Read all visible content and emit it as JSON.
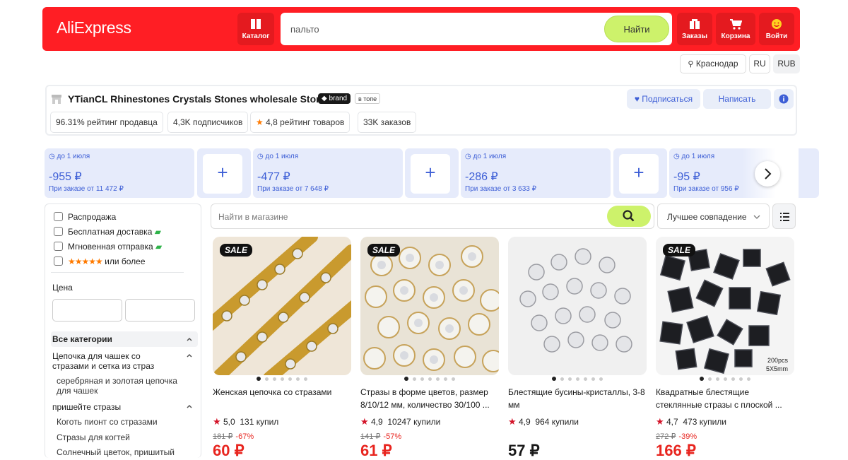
{
  "header": {
    "logo": "AliExpress",
    "catalog_label": "Каталог",
    "search_value": "пальто",
    "search_button": "Найти",
    "orders_label": "Заказы",
    "cart_label": "Корзина",
    "login_label": "Войти"
  },
  "region": {
    "city": "Краснодар",
    "lang": "RU",
    "currency": "RUB"
  },
  "store": {
    "name": "YTianCL Rhinestones Crystals Stones wholesale Store",
    "brand_badge": "brand",
    "top_badge": "в топе",
    "stats": [
      "96.31% рейтинг продавца",
      "4,3K подписчиков",
      "4,8 рейтинг товаров",
      "33K заказов"
    ],
    "follow_label": "Подписаться",
    "write_label": "Написать"
  },
  "coupons": [
    {
      "date": "до 1 июля",
      "amount": "-955 ₽",
      "condition": "При заказе от 11 472 ₽"
    },
    {
      "date": "до 1 июля",
      "amount": "-477 ₽",
      "condition": "При заказе от 7 648 ₽"
    },
    {
      "date": "до 1 июля",
      "amount": "-286 ₽",
      "condition": "При заказе от 3 633 ₽"
    },
    {
      "date": "до 1 июля",
      "amount": "-95 ₽",
      "condition": "При заказе от 956 ₽"
    }
  ],
  "filters": {
    "checkboxes": [
      "Распродажа",
      "Бесплатная доставка",
      "Мгновенная отправка",
      "или более"
    ],
    "price_label": "Цена",
    "all_categories": "Все категории",
    "cat1": "Цепочка для чашек со стразами и сетка из страз",
    "cat1_sub": "серебряная и золотая цепочка для чашек",
    "cat2": "пришейте стразы",
    "cat2_items": [
      "Коготь пионт со стразами",
      "Стразы для когтей",
      "Солнечный цветок, пришитый"
    ]
  },
  "shop_search": {
    "placeholder": "Найти в магазине",
    "sort": "Лучшее совпадение"
  },
  "products": [
    {
      "sale": "SALE",
      "title": "Женская цепочка со стразами",
      "rating": "5,0",
      "sold": "131 купил",
      "old_price": "181 ₽",
      "discount": "-67%",
      "price": "60 ₽"
    },
    {
      "sale": "SALE",
      "title": "Стразы в форме цветов, размер 8/10/12 мм, количество 30/100 ...",
      "rating": "4,9",
      "sold": "10247 купили",
      "old_price": "141 ₽",
      "discount": "-57%",
      "price": "61 ₽"
    },
    {
      "sale": "",
      "title": "Блестящие бусины-кристаллы, 3-8 мм",
      "rating": "4,9",
      "sold": "964 купили",
      "old_price": "",
      "discount": "",
      "price": "57 ₽"
    },
    {
      "sale": "SALE",
      "title": "Квадратные блестящие стеклянные стразы с плоской ...",
      "rating": "4,7",
      "sold": "473 купили",
      "old_price": "272 ₽",
      "discount": "-39%",
      "price": "166 ₽",
      "image_text": "200pcs 5X5mm"
    }
  ],
  "colors": {
    "brand_red": "#ff1e24",
    "accent_green": "#cdf26b",
    "coupon_blue": "#3e5fd6",
    "price_red": "#e8251f"
  }
}
